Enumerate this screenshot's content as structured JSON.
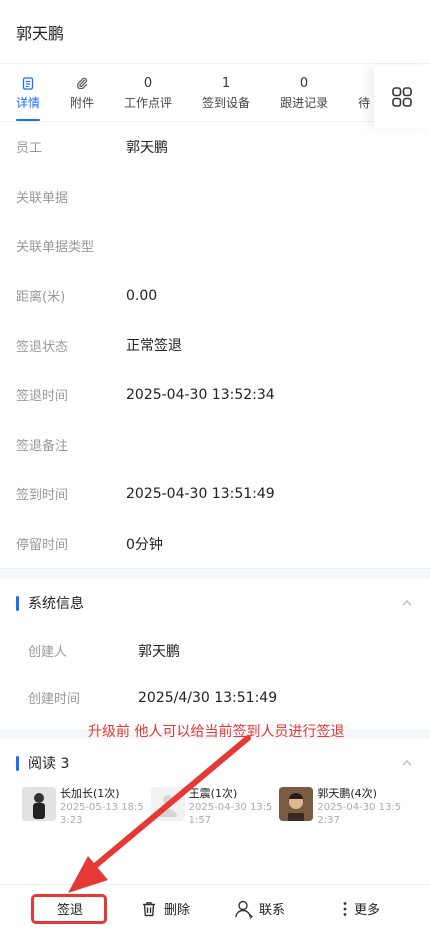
{
  "header": {
    "title": "郭天鹏"
  },
  "tabs": [
    {
      "label": "详情",
      "icon": "doc-icon",
      "active": true
    },
    {
      "label": "附件",
      "icon": "paperclip-icon"
    },
    {
      "label": "工作点评",
      "count": "0"
    },
    {
      "label": "签到设备",
      "count": "1"
    },
    {
      "label": "跟进记录",
      "count": "0"
    },
    {
      "label": "待",
      "partial": true
    }
  ],
  "tab_menu_icon": "grid-icon",
  "fields": [
    {
      "label": "员工",
      "value": "郭天鹏"
    },
    {
      "label": "关联单据",
      "value": ""
    },
    {
      "label": "关联单据类型",
      "value": ""
    },
    {
      "label": "距离(米)",
      "value": "0.00"
    },
    {
      "label": "签退状态",
      "value": "正常签退"
    },
    {
      "label": "签退时间",
      "value": "2025-04-30 13:52:34"
    },
    {
      "label": "签退备注",
      "value": ""
    },
    {
      "label": "签到时间",
      "value": "2025-04-30 13:51:49"
    },
    {
      "label": "停留时间",
      "value": "0分钟"
    }
  ],
  "system_info": {
    "title": "系统信息",
    "fields": [
      {
        "label": "创建人",
        "value": "郭天鹏"
      },
      {
        "label": "创建时间",
        "value": "2025/4/30 13:51:49"
      }
    ]
  },
  "readers": {
    "title": "阅读 3",
    "items": [
      {
        "name": "长加长(1次)",
        "date": "2025-05-13 18:53:23"
      },
      {
        "name": "王震(1次)",
        "date": "2025-04-30 13:51:57"
      },
      {
        "name": "郭天鹏(4次)",
        "date": "2025-04-30 13:52:37"
      }
    ]
  },
  "annotation": "升级前 他人可以给当前签到人员进行签退",
  "footer": {
    "checkout": "签退",
    "delete": "删除",
    "contact": "联系",
    "more": "更多"
  },
  "colors": {
    "accent": "#1a6dff",
    "annotation": "#e53935"
  }
}
